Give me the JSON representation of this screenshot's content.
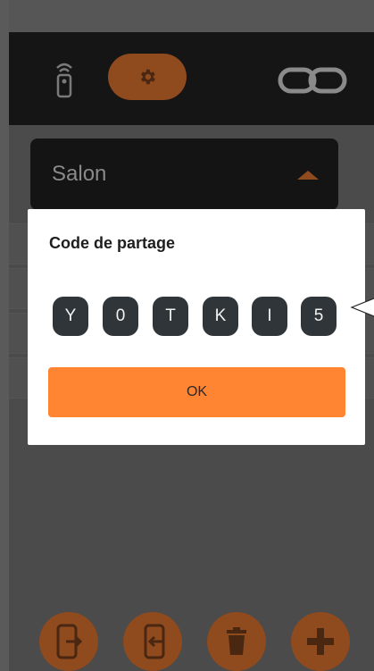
{
  "room_selector": {
    "value": "Salon"
  },
  "dialog": {
    "title": "Code de partage",
    "code": [
      "Y",
      "0",
      "T",
      "K",
      "I",
      "5"
    ],
    "ok_label": "OK"
  },
  "icons": {
    "remote": "remote-control-icon",
    "settings": "gear-icon",
    "link": "infinity-link-icon",
    "send_phone": "phone-send-icon",
    "receive_phone": "phone-receive-icon",
    "delete": "trash-icon",
    "add": "plus-icon"
  },
  "colors": {
    "accent": "#ff8533",
    "accent_dim": "#8f4a1e",
    "code_chip": "#2f3538",
    "topbar": "#151515"
  }
}
